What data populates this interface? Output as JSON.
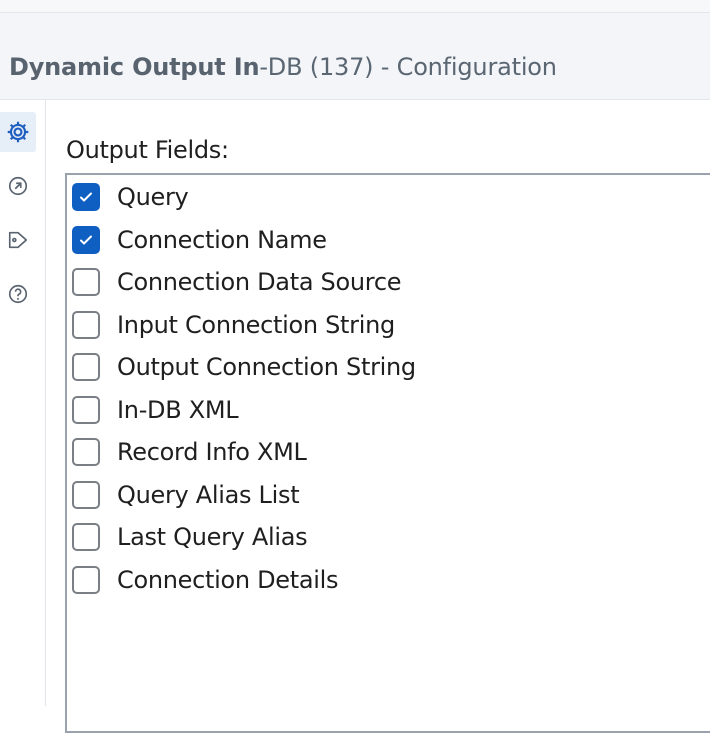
{
  "header": {
    "title_bold": "Dynamic Output In",
    "title_rest": "-DB (137) - Configuration"
  },
  "side_rail": {
    "items": [
      {
        "icon": "gear-icon",
        "active": true
      },
      {
        "icon": "navigate-arrow-icon",
        "active": false
      },
      {
        "icon": "tag-icon",
        "active": false
      },
      {
        "icon": "help-icon",
        "active": false
      }
    ]
  },
  "main": {
    "fields_label": "Output Fields:",
    "fields": [
      {
        "label": "Query",
        "checked": true
      },
      {
        "label": "Connection Name",
        "checked": true
      },
      {
        "label": "Connection Data Source",
        "checked": false
      },
      {
        "label": "Input Connection String",
        "checked": false
      },
      {
        "label": "Output Connection String",
        "checked": false
      },
      {
        "label": "In-DB XML",
        "checked": false
      },
      {
        "label": "Record Info XML",
        "checked": false
      },
      {
        "label": "Query Alias List",
        "checked": false
      },
      {
        "label": "Last Query Alias",
        "checked": false
      },
      {
        "label": "Connection Details",
        "checked": false
      }
    ]
  },
  "colors": {
    "accent": "#0f5fc2",
    "title_text": "#5b6673",
    "rail_icon": "#5a6370"
  }
}
